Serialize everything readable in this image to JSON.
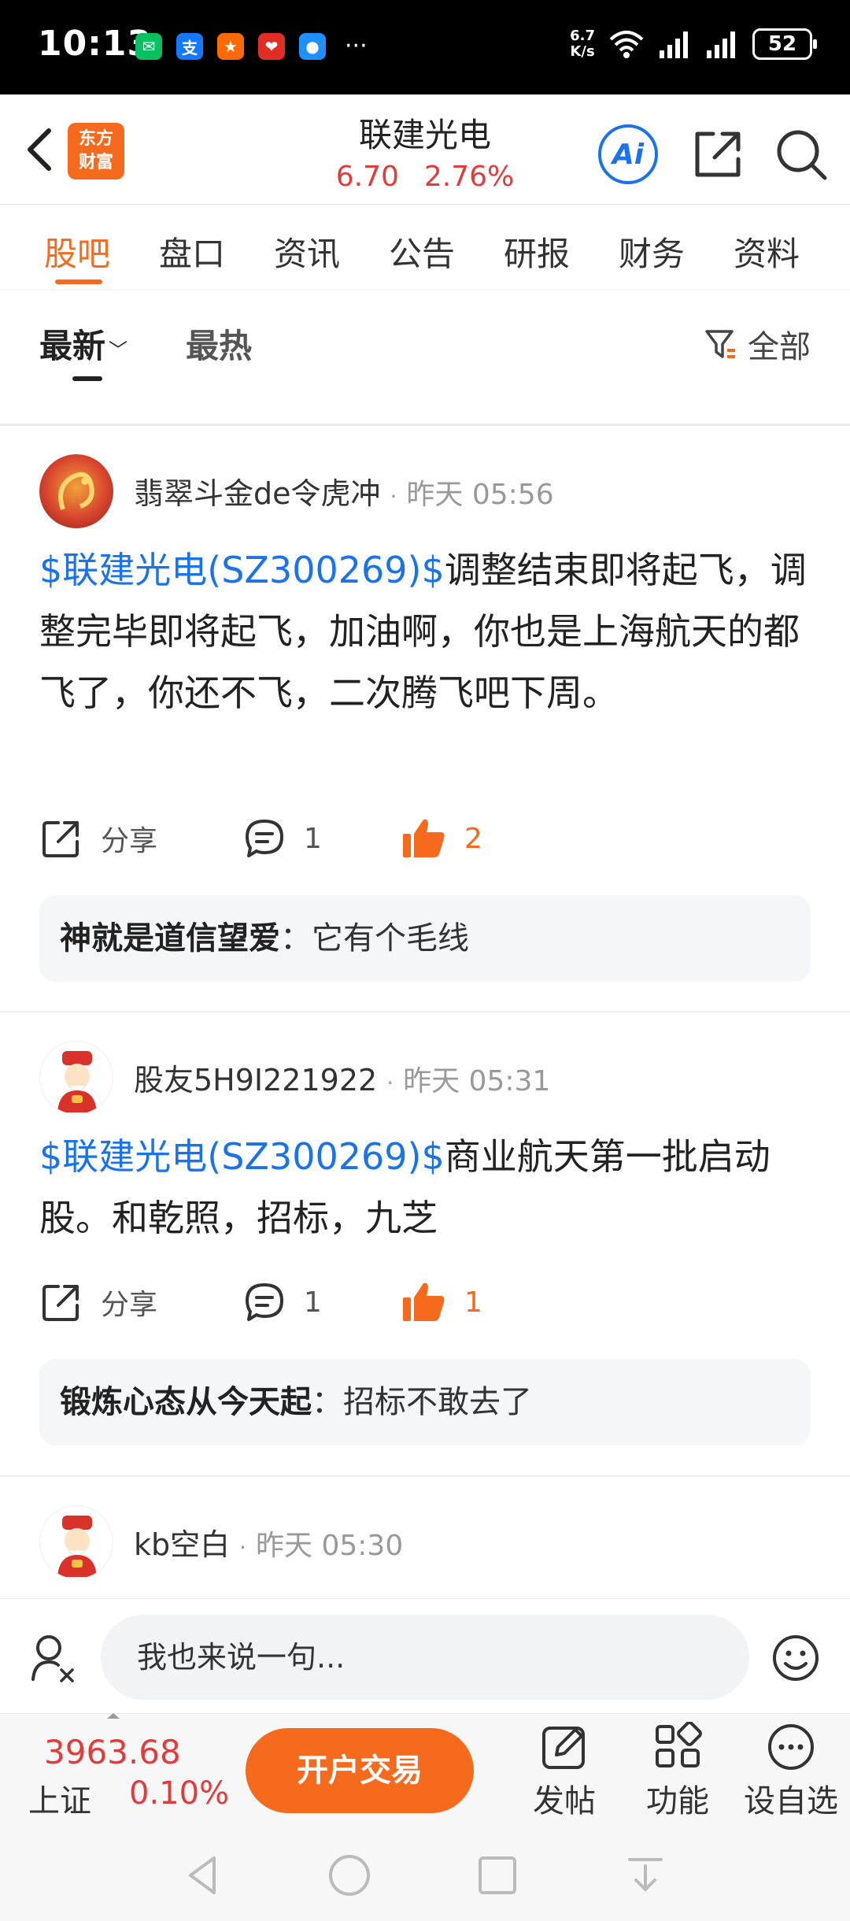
{
  "status_bar": {
    "time": "10:13",
    "net_speed_value": "6.7",
    "net_speed_unit": "K/s",
    "battery": "52",
    "more": "···"
  },
  "header": {
    "logo_line1": "东方",
    "logo_line2": "财富",
    "title": "联建光电",
    "price": "6.70",
    "change_pct": "2.76%",
    "ai_label": "Ai"
  },
  "tabs": [
    "股吧",
    "盘口",
    "资讯",
    "公告",
    "研报",
    "财务",
    "资料"
  ],
  "sort": {
    "latest": "最新",
    "hot": "最热",
    "filter": "全部"
  },
  "posts": [
    {
      "user": "翡翠斗金de令虎冲",
      "time": "昨天 05:56",
      "tag": "$联建光电(SZ300269)$",
      "text": "调整结束即将起飞，调整完毕即将起飞，加油啊，你也是上海航天的都飞了，你还不飞，二次腾飞吧下周。",
      "share_label": "分享",
      "comments": "1",
      "likes": "2",
      "reply_user": "神就是道信望爱",
      "reply_text": "：它有个毛线"
    },
    {
      "user": "股友5H9I221922",
      "time": "昨天 05:31",
      "tag": "$联建光电(SZ300269)$",
      "text": "商业航天第一批启动股。和乾照，招标，九芝",
      "share_label": "分享",
      "comments": "1",
      "likes": "1",
      "reply_user": "锻炼心态从今天起",
      "reply_text": "：招标不敢去了"
    },
    {
      "user": "kb空白",
      "time": "昨天 05:30"
    }
  ],
  "input": {
    "placeholder": "我也来说一句..."
  },
  "bottom": {
    "index_value": "3963.68",
    "index_name": "上证",
    "index_pct": "0.10%",
    "trade_label": "开户交易",
    "post_label": "发帖",
    "function_label": "功能",
    "watchlist_label": "设自选"
  },
  "colors": {
    "accent": "#f56a1d",
    "up": "#e23b3b",
    "link": "#1a73e8"
  }
}
